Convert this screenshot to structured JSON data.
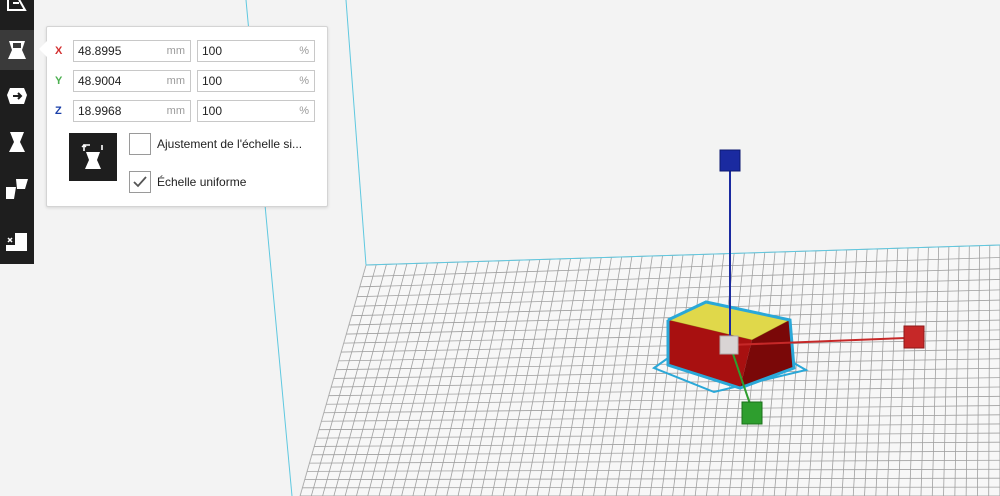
{
  "scale_panel": {
    "rows": [
      {
        "axis": "X",
        "axis_color": "#d32f2f",
        "value_mm": "48.8995",
        "unit_mm": "mm",
        "value_pct": "100",
        "unit_pct": "%"
      },
      {
        "axis": "Y",
        "axis_color": "#4caf50",
        "value_mm": "48.9004",
        "unit_mm": "mm",
        "value_pct": "100",
        "unit_pct": "%"
      },
      {
        "axis": "Z",
        "axis_color": "#1a3fa8",
        "value_mm": "18.9968",
        "unit_mm": "mm",
        "value_pct": "100",
        "unit_pct": "%"
      }
    ],
    "snap_scaling": {
      "label": "Ajustement de l'échelle si...",
      "checked": false
    },
    "uniform_scaling": {
      "label": "Échelle uniforme",
      "checked": true
    }
  },
  "toolbar": {
    "tools": [
      {
        "icon": "move-tool-icon",
        "active": false
      },
      {
        "icon": "scale-tool-icon",
        "active": true
      },
      {
        "icon": "rotate-tool-icon",
        "active": false
      },
      {
        "icon": "mirror-tool-icon",
        "active": false
      },
      {
        "icon": "per-model-settings-icon",
        "active": false
      },
      {
        "icon": "support-blocker-icon",
        "active": false
      }
    ]
  },
  "colors": {
    "axis_x": "#c62828",
    "axis_y": "#2e9e2e",
    "axis_z": "#1a2aa0",
    "model_side": "#8e0e0e",
    "model_top": "#e0d84a",
    "selection_outline": "#2aa8d8",
    "build_plate_grid": "#9a9a9a",
    "build_volume_line": "#5fc8e0"
  }
}
